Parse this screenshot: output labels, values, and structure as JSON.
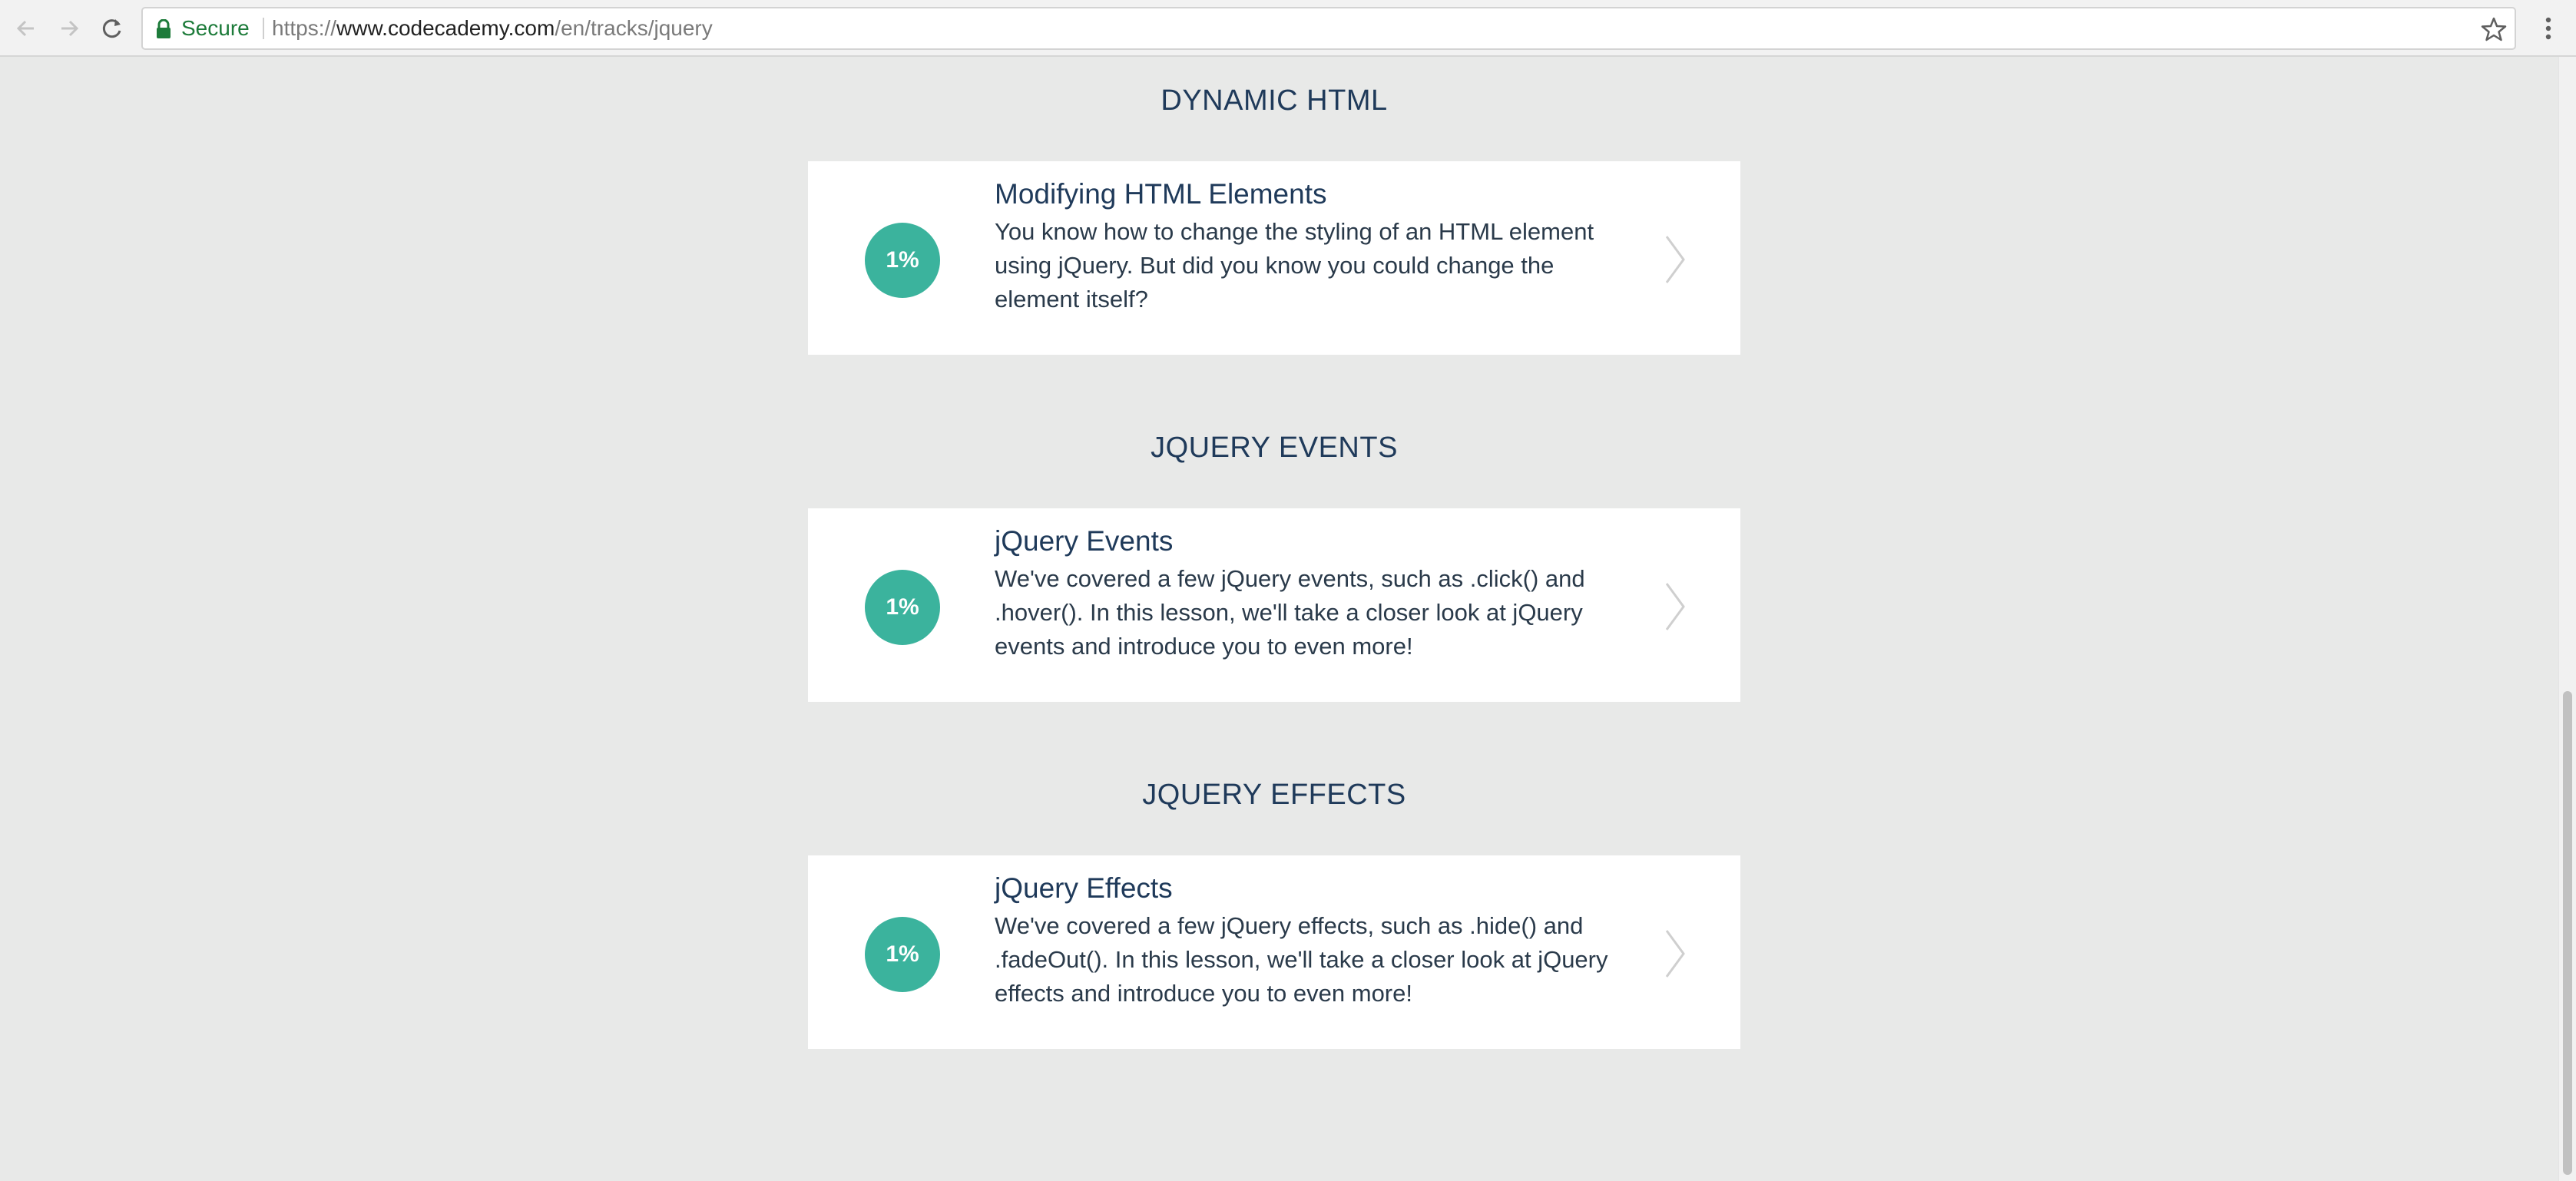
{
  "browser": {
    "secure_label": "Secure",
    "url_scheme": "https://",
    "url_host": "www.codecademy.com",
    "url_path": "/en/tracks/jquery",
    "icons": {
      "back": "arrow-left-icon",
      "forward": "arrow-right-icon",
      "reload": "reload-icon",
      "lock": "lock-icon",
      "star": "star-icon",
      "menu": "kebab-menu-icon"
    }
  },
  "sections": [
    {
      "title": "DYNAMIC HTML",
      "lesson": {
        "progress": "1%",
        "title": "Modifying HTML Elements",
        "description": "You know how to change the styling of an HTML element using jQuery. But did you know you could change the element itself?"
      }
    },
    {
      "title": "JQUERY EVENTS",
      "lesson": {
        "progress": "1%",
        "title": "jQuery Events",
        "description": "We've covered a few jQuery events, such as .click() and .hover(). In this lesson, we'll take a closer look at jQuery events and introduce you to even more!"
      }
    },
    {
      "title": "JQUERY EFFECTS",
      "lesson": {
        "progress": "1%",
        "title": "jQuery Effects",
        "description": "We've covered a few jQuery effects, such as .hide() and .fadeOut(). In this lesson, we'll take a closer look at jQuery effects and introduce you to even more!"
      }
    }
  ],
  "colors": {
    "background": "#e8e9e8",
    "progress_circle": "#3bb39d",
    "heading": "#1f3a5a",
    "secure_green": "#1d7b3a"
  }
}
